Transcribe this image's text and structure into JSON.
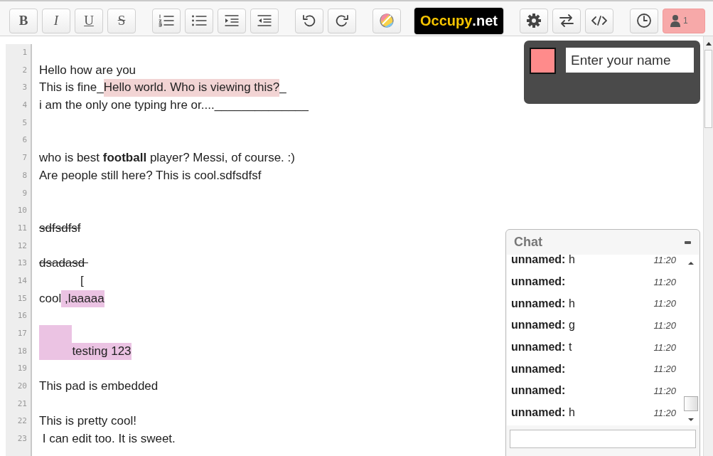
{
  "toolbar": {
    "groups": [
      [
        {
          "kind": "bold",
          "label": "B"
        },
        {
          "kind": "italic",
          "label": "I"
        },
        {
          "kind": "underline",
          "label": "U"
        },
        {
          "kind": "strike",
          "label": "S"
        }
      ],
      [
        {
          "kind": "ordered-list"
        },
        {
          "kind": "bullet-list"
        },
        {
          "kind": "indent"
        },
        {
          "kind": "outdent"
        }
      ],
      [
        {
          "kind": "undo"
        },
        {
          "kind": "redo"
        }
      ],
      [
        {
          "kind": "color"
        }
      ],
      [
        {
          "kind": "logo",
          "brand": "Occupy",
          "suffix": ".net"
        }
      ],
      [
        {
          "kind": "settings"
        },
        {
          "kind": "import-export"
        },
        {
          "kind": "embed"
        }
      ],
      [
        {
          "kind": "history"
        },
        {
          "kind": "users",
          "count": "1"
        }
      ]
    ]
  },
  "editor": {
    "lines": [
      {
        "number": "1"
      },
      {
        "number": "2",
        "segments": [
          {
            "text": "Hello how are you"
          }
        ]
      },
      {
        "number": "3",
        "segments": [
          {
            "text": "This is fine_"
          },
          {
            "text": "Hello world. Who is viewing this?",
            "color": "#f2d4d4"
          },
          {
            "text": "_"
          }
        ]
      },
      {
        "number": "4",
        "segments": [
          {
            "text": "i am the only one typing hre or....______________"
          }
        ]
      },
      {
        "number": "5"
      },
      {
        "number": "6"
      },
      {
        "number": "7",
        "segments": [
          {
            "text": "who is best **football** player? Messi, of course. :)"
          }
        ]
      },
      {
        "number": "8",
        "segments": [
          {
            "text": "Are people still here? This is cool.sdfsdfsf"
          }
        ]
      },
      {
        "number": "9"
      },
      {
        "number": "10"
      },
      {
        "number": "11",
        "segments": [
          {
            "text": "sdfsdfsf",
            "strike": true
          }
        ]
      },
      {
        "number": "12"
      },
      {
        "number": "13",
        "segments": [
          {
            "text": "dsadasd ",
            "strike": true
          }
        ]
      },
      {
        "number": "14",
        "segments": [
          {
            "kind": "tab"
          },
          {
            "kind": "tab"
          },
          {
            "kind": "tab"
          },
          {
            "kind": "tab"
          },
          {
            "kind": "tab"
          },
          {
            "text": "["
          }
        ]
      },
      {
        "number": "15",
        "segments": [
          {
            "text": "cool"
          },
          {
            "text": " ,laaaaa",
            "color": "#ebc3e3"
          }
        ]
      },
      {
        "number": "16"
      },
      {
        "number": "17",
        "segments": [
          {
            "kind": "tab",
            "color": "#ebc3e3"
          },
          {
            "kind": "tab",
            "color": "#ebc3e3"
          },
          {
            "kind": "tab",
            "color": "#ebc3e3"
          },
          {
            "kind": "tab",
            "color": "#ebc3e3"
          }
        ]
      },
      {
        "number": "18",
        "segments": [
          {
            "kind": "tab",
            "color": "#ebc3e3"
          },
          {
            "kind": "tab",
            "color": "#ebc3e3"
          },
          {
            "kind": "tab",
            "color": "#ebc3e3"
          },
          {
            "kind": "tab",
            "color": "#ebc3e3"
          },
          {
            "text": "testing 123",
            "color": "#ebc3e3"
          }
        ]
      },
      {
        "number": "19"
      },
      {
        "number": "20",
        "segments": [
          {
            "text": "This pad is embedded"
          }
        ]
      },
      {
        "number": "21"
      },
      {
        "number": "22",
        "segments": [
          {
            "text": "This is pretty cool!"
          }
        ]
      },
      {
        "number": "23",
        "segments": [
          {
            "text": " I can edit too. It is sweet."
          }
        ]
      }
    ]
  },
  "user_panel": {
    "color": "#ff8b8b",
    "name_placeholder": "Enter your name"
  },
  "chat": {
    "title": "Chat",
    "messages": [
      {
        "author": "unnamed:",
        "text": "h",
        "time": "11:20"
      },
      {
        "author": "unnamed:",
        "time": "11:20"
      },
      {
        "author": "unnamed:",
        "text": "h",
        "time": "11:20"
      },
      {
        "author": "unnamed:",
        "text": "g",
        "time": "11:20"
      },
      {
        "author": "unnamed:",
        "text": "t",
        "time": "11:20"
      },
      {
        "author": "unnamed:",
        "time": "11:20"
      },
      {
        "author": "unnamed:",
        "time": "11:20"
      },
      {
        "author": "unnamed:",
        "text": "h",
        "time": "11:20"
      }
    ]
  }
}
